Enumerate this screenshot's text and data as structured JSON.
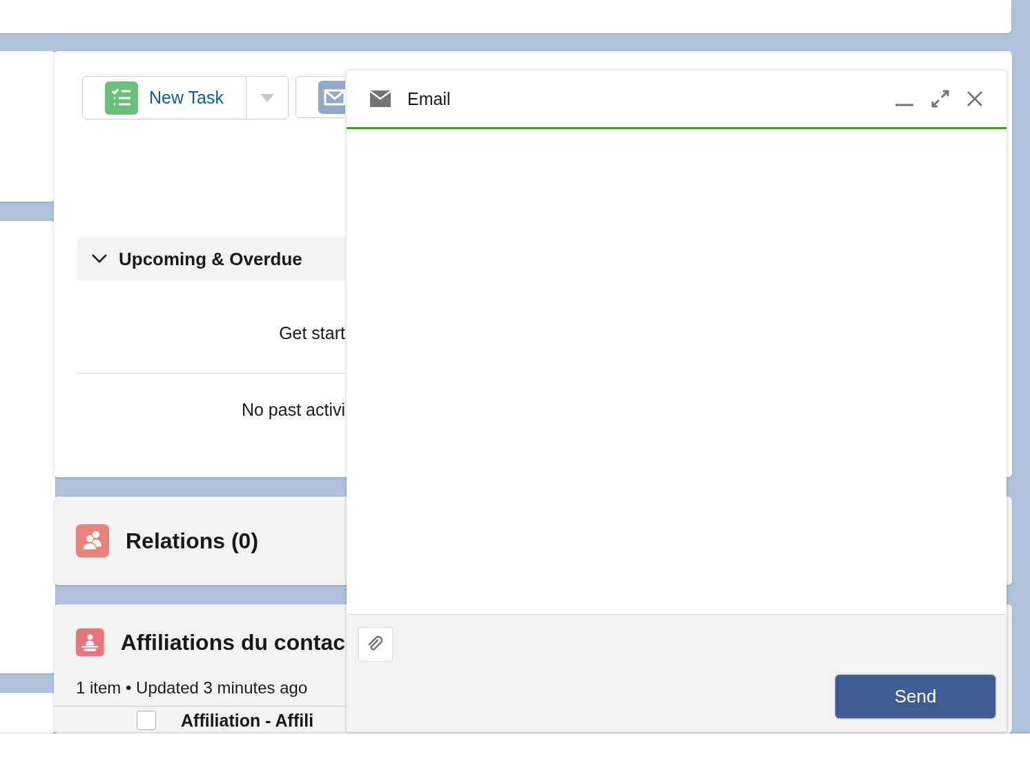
{
  "activity": {
    "actions": [
      {
        "kind": "task",
        "label": "New Task"
      },
      {
        "kind": "email"
      }
    ],
    "section": {
      "title": "Upcoming & Overdue",
      "expanded": true
    },
    "upcoming_message": "Get start",
    "past_message": "No past activi"
  },
  "relations": {
    "title": "Relations (0)"
  },
  "affiliations": {
    "title": "Affiliations du contac",
    "meta": "1 item • Updated 3 minutes ago",
    "rows": [
      {
        "text": "Affiliation - Affili",
        "checked": false
      }
    ]
  },
  "email_panel": {
    "title": "Email",
    "send": "Send"
  }
}
